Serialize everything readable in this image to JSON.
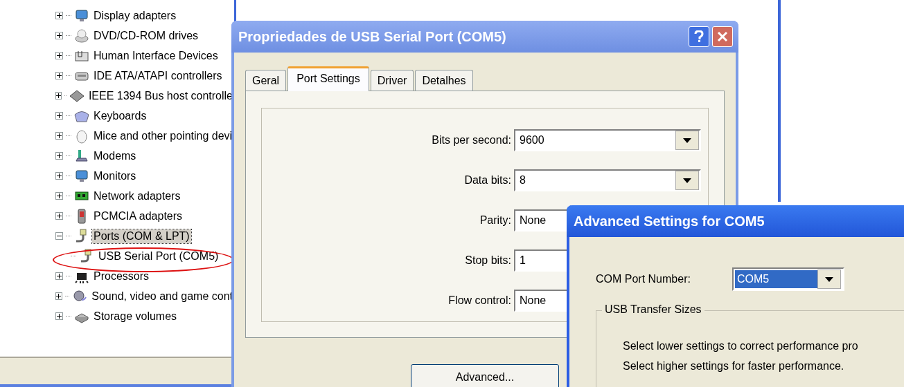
{
  "device_tree": {
    "items": [
      {
        "label": "Display adapters",
        "expanded": false,
        "selected": false
      },
      {
        "label": "DVD/CD-ROM drives",
        "expanded": false,
        "selected": false
      },
      {
        "label": "Human Interface Devices",
        "expanded": false,
        "selected": false
      },
      {
        "label": "IDE ATA/ATAPI controllers",
        "expanded": false,
        "selected": false
      },
      {
        "label": "IEEE 1394 Bus host controlle",
        "expanded": false,
        "selected": false
      },
      {
        "label": "Keyboards",
        "expanded": false,
        "selected": false
      },
      {
        "label": "Mice and other pointing devi",
        "expanded": false,
        "selected": false
      },
      {
        "label": "Modems",
        "expanded": false,
        "selected": false
      },
      {
        "label": "Monitors",
        "expanded": false,
        "selected": false
      },
      {
        "label": "Network adapters",
        "expanded": false,
        "selected": false
      },
      {
        "label": "PCMCIA adapters",
        "expanded": false,
        "selected": false
      },
      {
        "label": "Ports (COM & LPT)",
        "expanded": true,
        "selected": true,
        "children": [
          {
            "label": "USB Serial Port (COM5)",
            "selected": false
          }
        ]
      },
      {
        "label": "Processors",
        "expanded": false,
        "selected": false
      },
      {
        "label": "Sound, video and game cont",
        "expanded": false,
        "selected": false
      },
      {
        "label": "Storage volumes",
        "expanded": false,
        "selected": false
      }
    ]
  },
  "properties_dialog": {
    "title": "Propriedades de USB Serial Port (COM5)",
    "tabs": [
      {
        "label": "Geral",
        "selected": false
      },
      {
        "label": "Port Settings",
        "selected": true
      },
      {
        "label": "Driver",
        "selected": false
      },
      {
        "label": "Detalhes",
        "selected": false
      }
    ],
    "fields": [
      {
        "label": "Bits per second:",
        "value": "9600"
      },
      {
        "label": "Data bits:",
        "value": "8"
      },
      {
        "label": "Parity:",
        "value": "None"
      },
      {
        "label": "Stop bits:",
        "value": "1"
      },
      {
        "label": "Flow control:",
        "value": "None"
      }
    ],
    "button": "Advanced..."
  },
  "advanced_dialog": {
    "title": "Advanced Settings for COM5",
    "com_port": {
      "label": "COM Port Number:",
      "value": "COM5",
      "focused": true
    },
    "group_title": "USB Transfer Sizes",
    "lines": [
      "Select lower settings to correct performance pro",
      "Select higher settings for faster performance."
    ]
  }
}
